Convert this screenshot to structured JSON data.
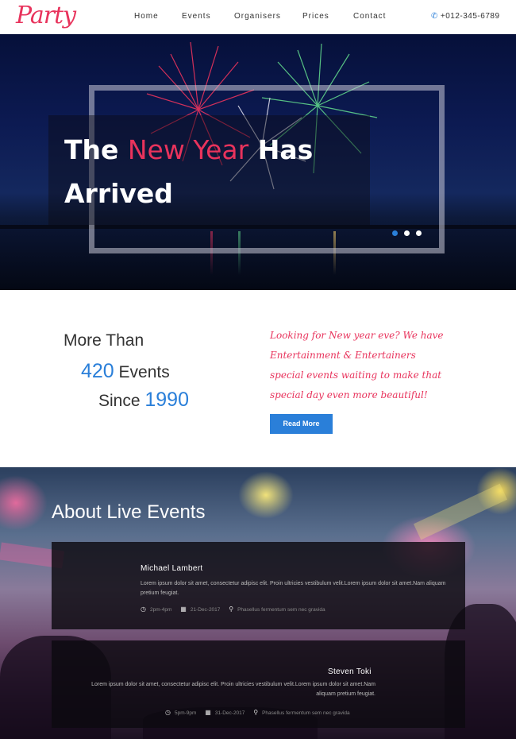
{
  "brand": {
    "logo_text": "Party"
  },
  "nav": {
    "items": [
      {
        "label": "Home"
      },
      {
        "label": "Events"
      },
      {
        "label": "Organisers"
      },
      {
        "label": "Prices"
      },
      {
        "label": "Contact"
      }
    ],
    "phone": "+012-345-6789",
    "phone_icon": "phone-icon"
  },
  "hero": {
    "title_part1": "The ",
    "title_accent": "New Year",
    "title_part2": " Has Arrived",
    "slides_total": 3,
    "slide_active": 1
  },
  "intro": {
    "line1": "More Than",
    "count": "420",
    "line2_suffix": " Events",
    "line3_prefix": "Since ",
    "year": "1990",
    "text": "Looking for New year eve? We have Entertainment & Entertainers special events waiting to make that special day even more beautiful!",
    "button_label": "Read More"
  },
  "events": {
    "title": "About Live Events",
    "items": [
      {
        "name": "Michael Lambert",
        "description": "Lorem ipsum dolor sit amet, consectetur adipisc elit. Proin ultricies vestibulum velit.Lorem ipsum dolor sit amet.Nam aliquam pretium feugiat.",
        "time": "2pm-4pm",
        "date": "21-Dec-2017",
        "location": "Phasellus fermentum sem nec gravida"
      },
      {
        "name": "Steven Toki",
        "description": "Lorem ipsum dolor sit amet, consectetur adipisc elit. Proin ultricies vestibulum velit.Lorem ipsum dolor sit amet.Nam aliquam pretium feugiat.",
        "time": "5pm-9pm",
        "date": "31-Dec-2017",
        "location": "Phasellus fermentum sem nec gravida"
      }
    ]
  },
  "colors": {
    "accent": "#e8335c",
    "primary": "#2a7fd9"
  }
}
